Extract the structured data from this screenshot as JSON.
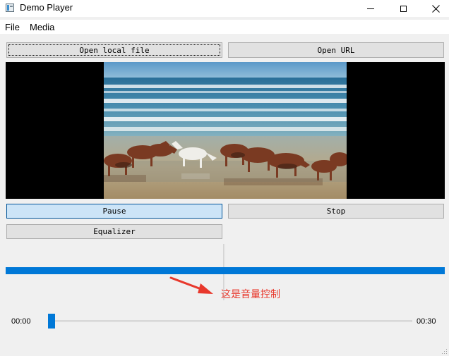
{
  "window": {
    "title": "Demo Player"
  },
  "menu": {
    "items": [
      {
        "label": "File"
      },
      {
        "label": "Media"
      }
    ]
  },
  "buttons": {
    "open_local": "Open local file",
    "open_url": "Open URL",
    "pause": "Pause",
    "stop": "Stop",
    "equalizer": "Equalizer"
  },
  "volume": {
    "level": 1.0
  },
  "annotation": {
    "text": "这是音量控制"
  },
  "position": {
    "current_time": "00:00",
    "total_time": "00:30",
    "level": 0.0
  },
  "colors": {
    "accent": "#0078d7",
    "annotation": "#e8382c",
    "pressed_button": "#cce4f7"
  },
  "icons": [
    "app-icon",
    "minimize-icon",
    "maximize-icon",
    "close-icon",
    "size-grip-icon"
  ]
}
